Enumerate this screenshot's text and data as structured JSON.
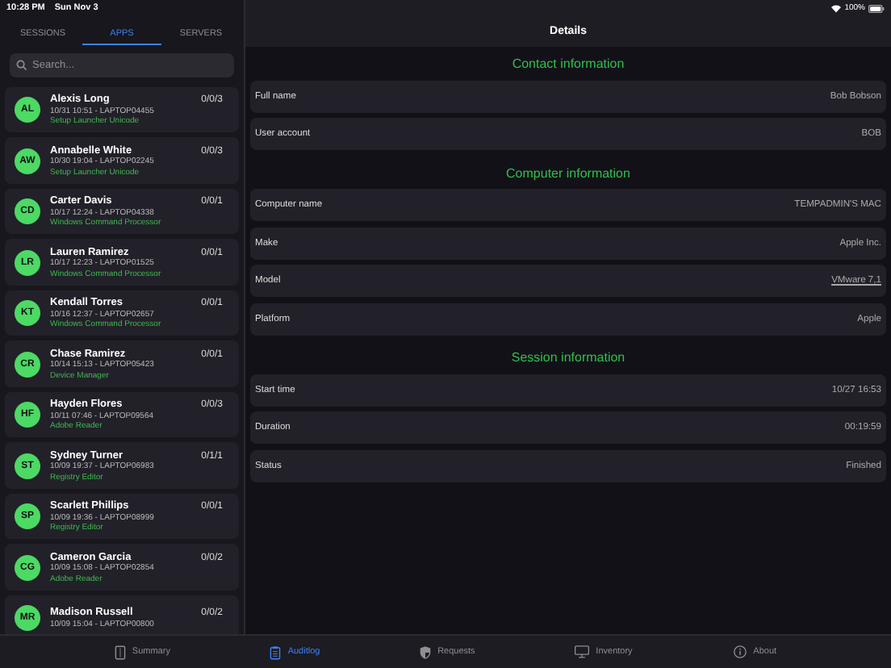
{
  "status_bar": {
    "time": "10:28 PM",
    "date": "Sun Nov 3",
    "battery": "100%"
  },
  "segments": [
    {
      "label": "SESSIONS",
      "selected": false
    },
    {
      "label": "APPS",
      "selected": true
    },
    {
      "label": "SERVERS",
      "selected": false
    }
  ],
  "search": {
    "placeholder": "Search..."
  },
  "sessions": [
    {
      "initials": "AL",
      "name": "Alexis Long",
      "meta": "10/31 10:51 - LAPTOP04455",
      "app": "Setup Launcher Unicode",
      "count": "0/0/3"
    },
    {
      "initials": "AW",
      "name": "Annabelle White",
      "meta": "10/30 19:04 - LAPTOP02245",
      "app": "Setup Launcher Unicode",
      "count": "0/0/3"
    },
    {
      "initials": "CD",
      "name": "Carter Davis",
      "meta": "10/17 12:24 - LAPTOP04338",
      "app": "Windows Command Processor",
      "count": "0/0/1"
    },
    {
      "initials": "LR",
      "name": "Lauren Ramirez",
      "meta": "10/17 12:23 - LAPTOP01525",
      "app": "Windows Command Processor",
      "count": "0/0/1"
    },
    {
      "initials": "KT",
      "name": "Kendall Torres",
      "meta": "10/16 12:37 - LAPTOP02657",
      "app": "Windows Command Processor",
      "count": "0/0/1"
    },
    {
      "initials": "CR",
      "name": "Chase Ramirez",
      "meta": "10/14 15:13 - LAPTOP05423",
      "app": "Device Manager",
      "count": "0/0/1"
    },
    {
      "initials": "HF",
      "name": "Hayden Flores",
      "meta": "10/11 07:46 - LAPTOP09564",
      "app": "Adobe Reader",
      "count": "0/0/3"
    },
    {
      "initials": "ST",
      "name": "Sydney Turner",
      "meta": "10/09 19:37 - LAPTOP06983",
      "app": "Registry Editor",
      "count": "0/1/1"
    },
    {
      "initials": "SP",
      "name": "Scarlett Phillips",
      "meta": "10/09 19:36 - LAPTOP08999",
      "app": "Registry Editor",
      "count": "0/0/1"
    },
    {
      "initials": "CG",
      "name": "Cameron Garcia",
      "meta": "10/09 15:08 - LAPTOP02854",
      "app": "Adobe Reader",
      "count": "0/0/2"
    },
    {
      "initials": "MR",
      "name": "Madison Russell",
      "meta": "10/09 15:04 - LAPTOP00800",
      "count": "0/0/2"
    }
  ],
  "details": {
    "title": "Details",
    "sections": [
      {
        "title": "Contact information",
        "rows": [
          {
            "label": "Full name",
            "value": "Bob Bobson",
            "kind": "text"
          },
          {
            "label": "User account",
            "value": "BOB",
            "kind": "text"
          }
        ]
      },
      {
        "title": "Computer information",
        "rows": [
          {
            "label": "Computer name",
            "value": "TEMPADMIN'S MAC",
            "kind": "text"
          },
          {
            "label": "Make",
            "value": "Apple Inc.",
            "kind": "text"
          },
          {
            "label": "Model",
            "value": "VMware 7,1",
            "kind": "link"
          },
          {
            "label": "Platform",
            "value": "Apple",
            "kind": "text"
          }
        ]
      },
      {
        "title": "Session information",
        "rows": [
          {
            "label": "Start time",
            "value": "10/27 16:53",
            "kind": "text"
          },
          {
            "label": "Duration",
            "value": "00:19:59",
            "kind": "text"
          },
          {
            "label": "Status",
            "value": "Finished",
            "kind": "text"
          }
        ]
      }
    ]
  },
  "tab_bar": [
    {
      "label": "Summary",
      "selected": false
    },
    {
      "label": "Auditlog",
      "selected": true
    },
    {
      "label": "Requests",
      "selected": false
    },
    {
      "label": "Inventory",
      "selected": false
    },
    {
      "label": "About",
      "selected": false
    }
  ]
}
